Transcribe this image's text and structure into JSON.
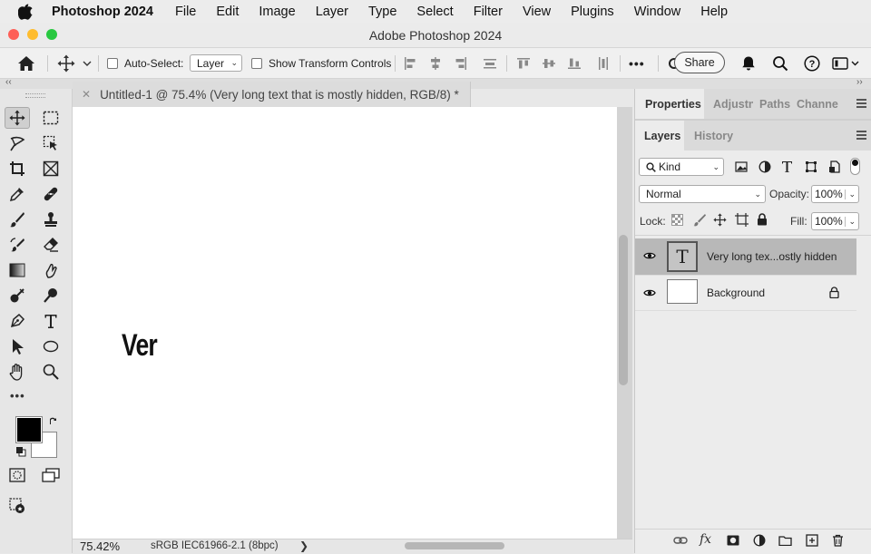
{
  "menubar": {
    "app_name": "Photoshop 2024",
    "items": [
      "File",
      "Edit",
      "Image",
      "Layer",
      "Type",
      "Select",
      "Filter",
      "View",
      "Plugins",
      "Window",
      "Help"
    ]
  },
  "window": {
    "title": "Adobe Photoshop 2024",
    "traffic_lights": {
      "close": "#fe5f57",
      "minimize": "#febc2e",
      "zoom": "#28c840"
    }
  },
  "options": {
    "auto_select_label": "Auto-Select:",
    "auto_select_checked": false,
    "auto_select_value": "Layer",
    "show_transform_label": "Show Transform Controls",
    "show_transform_checked": false,
    "more_label": "•••",
    "share_label": "Share"
  },
  "toolbar": {
    "more_label": "•••",
    "foreground_color": "#000000",
    "background_color": "#ffffff"
  },
  "document": {
    "tab_title": "Untitled-1 @ 75.4% (Very long text that is mostly hidden, RGB/8) *",
    "canvas_text": "Ver",
    "zoom": "75.42%",
    "color_profile": "sRGB IEC61966-2.1 (8bpc)",
    "status_arrow": "❯"
  },
  "panels": {
    "top_tabs": [
      "Properties",
      "Adjustn",
      "Paths",
      "Channe"
    ],
    "layer_tabs": [
      "Layers",
      "History"
    ],
    "filter_kind": "Kind",
    "blend_mode": "Normal",
    "opacity_label": "Opacity:",
    "opacity_value": "100%",
    "lock_label": "Lock:",
    "fill_label": "Fill:",
    "fill_value": "100%",
    "layers": [
      {
        "name": "Very long tex...ostly hidden",
        "type": "text",
        "thumb_glyph": "T",
        "selected": true,
        "visible": true
      },
      {
        "name": "Background",
        "type": "pixel",
        "locked": true,
        "selected": false,
        "visible": true
      }
    ]
  },
  "colors": {
    "selected_layer": "#b8b8b8",
    "panel_bg": "#ececec",
    "canvas": "#ffffff",
    "pasteboard": "#d3d3d3"
  }
}
